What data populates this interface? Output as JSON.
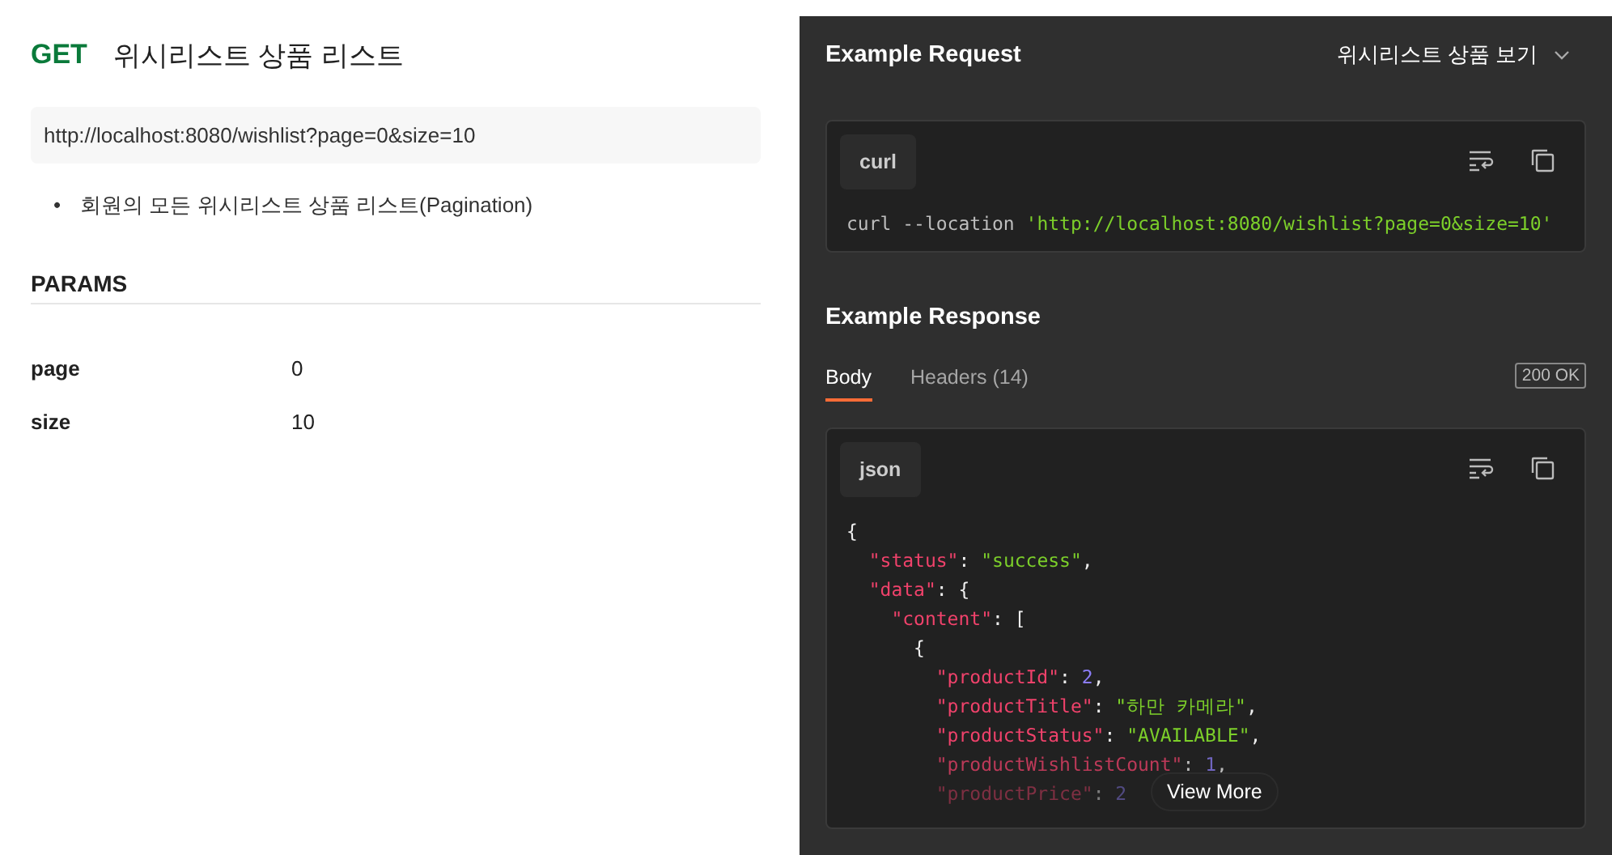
{
  "request": {
    "method": "GET",
    "title": "위시리스트 상품 리스트",
    "url": "http://localhost:8080/wishlist?page=0&size=10",
    "notes": [
      {
        "marker": "•",
        "text": "회원의 모든 위시리스트 상품 리스트(Pagination)"
      }
    ]
  },
  "params": {
    "title": "PARAMS",
    "rows": [
      {
        "name": "page",
        "value": "0"
      },
      {
        "name": "size",
        "value": "10"
      }
    ]
  },
  "example_request": {
    "title": "Example Request",
    "selector": "위시리스트 상품 보기",
    "language": "curl",
    "code": [
      {
        "kind": "plain",
        "text": "curl --location "
      },
      {
        "kind": "string",
        "text": "'http://localhost:8080/wishlist?page=0&size=10'"
      }
    ]
  },
  "example_response": {
    "title": "Example Response",
    "tabs": [
      {
        "label": "Body",
        "selected": true
      },
      {
        "label": "Headers (14)",
        "selected": false
      }
    ],
    "status": "200 OK",
    "language": "json",
    "view_more": "View More",
    "lines": [
      [
        {
          "kind": "punct",
          "text": "{"
        }
      ],
      [
        {
          "kind": "key",
          "text": "\"status\""
        },
        {
          "kind": "punct",
          "text": ": "
        },
        {
          "kind": "string",
          "text": "\"success\""
        },
        {
          "kind": "punct",
          "text": ","
        }
      ],
      [
        {
          "kind": "key",
          "text": "\"data\""
        },
        {
          "kind": "punct",
          "text": ": {"
        }
      ],
      [
        {
          "kind": "key",
          "text": "\"content\""
        },
        {
          "kind": "punct",
          "text": ": ["
        }
      ],
      [
        {
          "kind": "punct",
          "text": "{"
        }
      ],
      [
        {
          "kind": "key",
          "text": "\"productId\""
        },
        {
          "kind": "punct",
          "text": ": "
        },
        {
          "kind": "number",
          "text": "2"
        },
        {
          "kind": "punct",
          "text": ","
        }
      ],
      [
        {
          "kind": "key",
          "text": "\"productTitle\""
        },
        {
          "kind": "punct",
          "text": ": "
        },
        {
          "kind": "string",
          "text": "\"하만 카메라\""
        },
        {
          "kind": "punct",
          "text": ","
        }
      ],
      [
        {
          "kind": "key",
          "text": "\"productStatus\""
        },
        {
          "kind": "punct",
          "text": ": "
        },
        {
          "kind": "string",
          "text": "\"AVAILABLE\""
        },
        {
          "kind": "punct",
          "text": ","
        }
      ],
      [
        {
          "kind": "key",
          "text": "\"productWishlistCount\""
        },
        {
          "kind": "punct",
          "text": ": "
        },
        {
          "kind": "number",
          "text": "1"
        },
        {
          "kind": "punct",
          "text": ","
        }
      ],
      [
        {
          "kind": "key",
          "text": "\"productPrice\""
        },
        {
          "kind": "punct",
          "text": ": "
        },
        {
          "kind": "number",
          "text": "2"
        }
      ]
    ]
  }
}
